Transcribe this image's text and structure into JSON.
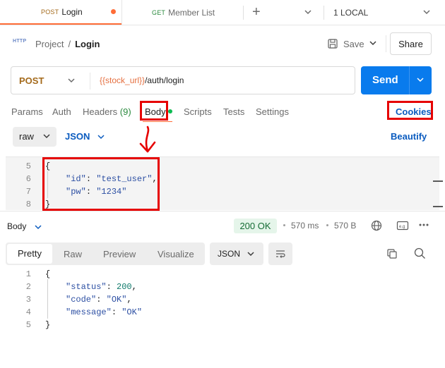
{
  "tabs": {
    "active": {
      "method": "POST",
      "label": "Login"
    },
    "second": {
      "method": "GET",
      "label": "Member List"
    },
    "environment": "1 LOCAL"
  },
  "breadcrumb": {
    "project": "Project",
    "separator": "/",
    "current": "Login"
  },
  "toolbar": {
    "save_label": "Save",
    "share_label": "Share"
  },
  "request": {
    "method": "POST",
    "url_variable": "{{stock_url}}",
    "url_path": "/auth/login",
    "send_label": "Send"
  },
  "request_tabs": {
    "params": "Params",
    "auth": "Auth",
    "headers": "Headers",
    "headers_count": "(9)",
    "body": "Body",
    "scripts": "Scripts",
    "tests": "Tests",
    "settings": "Settings",
    "cookies": "Cookies"
  },
  "body_options": {
    "mode": "raw",
    "language": "JSON",
    "beautify": "Beautify"
  },
  "request_editor": {
    "lines": [
      {
        "no": "5",
        "text": "{"
      },
      {
        "no": "6",
        "key": "\"id\"",
        "colon": ": ",
        "value": "\"test_user\"",
        "tail": ","
      },
      {
        "no": "7",
        "key": "\"pw\"",
        "colon": ": ",
        "value": "\"1234\"",
        "tail": ""
      },
      {
        "no": "8",
        "text": "}"
      }
    ]
  },
  "response": {
    "section_label": "Body",
    "status": "200 OK",
    "time": "570 ms",
    "size": "570 B",
    "view_tabs": [
      "Pretty",
      "Raw",
      "Preview",
      "Visualize"
    ],
    "format": "JSON",
    "lines": [
      {
        "no": "1",
        "text": "{"
      },
      {
        "no": "2",
        "key": "\"status\"",
        "colon": ": ",
        "value": "200",
        "tail": ","
      },
      {
        "no": "3",
        "key": "\"code\"",
        "colon": ": ",
        "value": "\"OK\"",
        "tail": ","
      },
      {
        "no": "4",
        "key": "\"message\"",
        "colon": ": ",
        "value": "\"OK\"",
        "tail": ""
      },
      {
        "no": "5",
        "text": "}"
      }
    ]
  },
  "colors": {
    "accent": "#ff6c37",
    "send_button": "#097bed",
    "link": "#0a5bbf",
    "status_ok_bg": "#e5f5ea",
    "annotation_red": "#e60000"
  }
}
